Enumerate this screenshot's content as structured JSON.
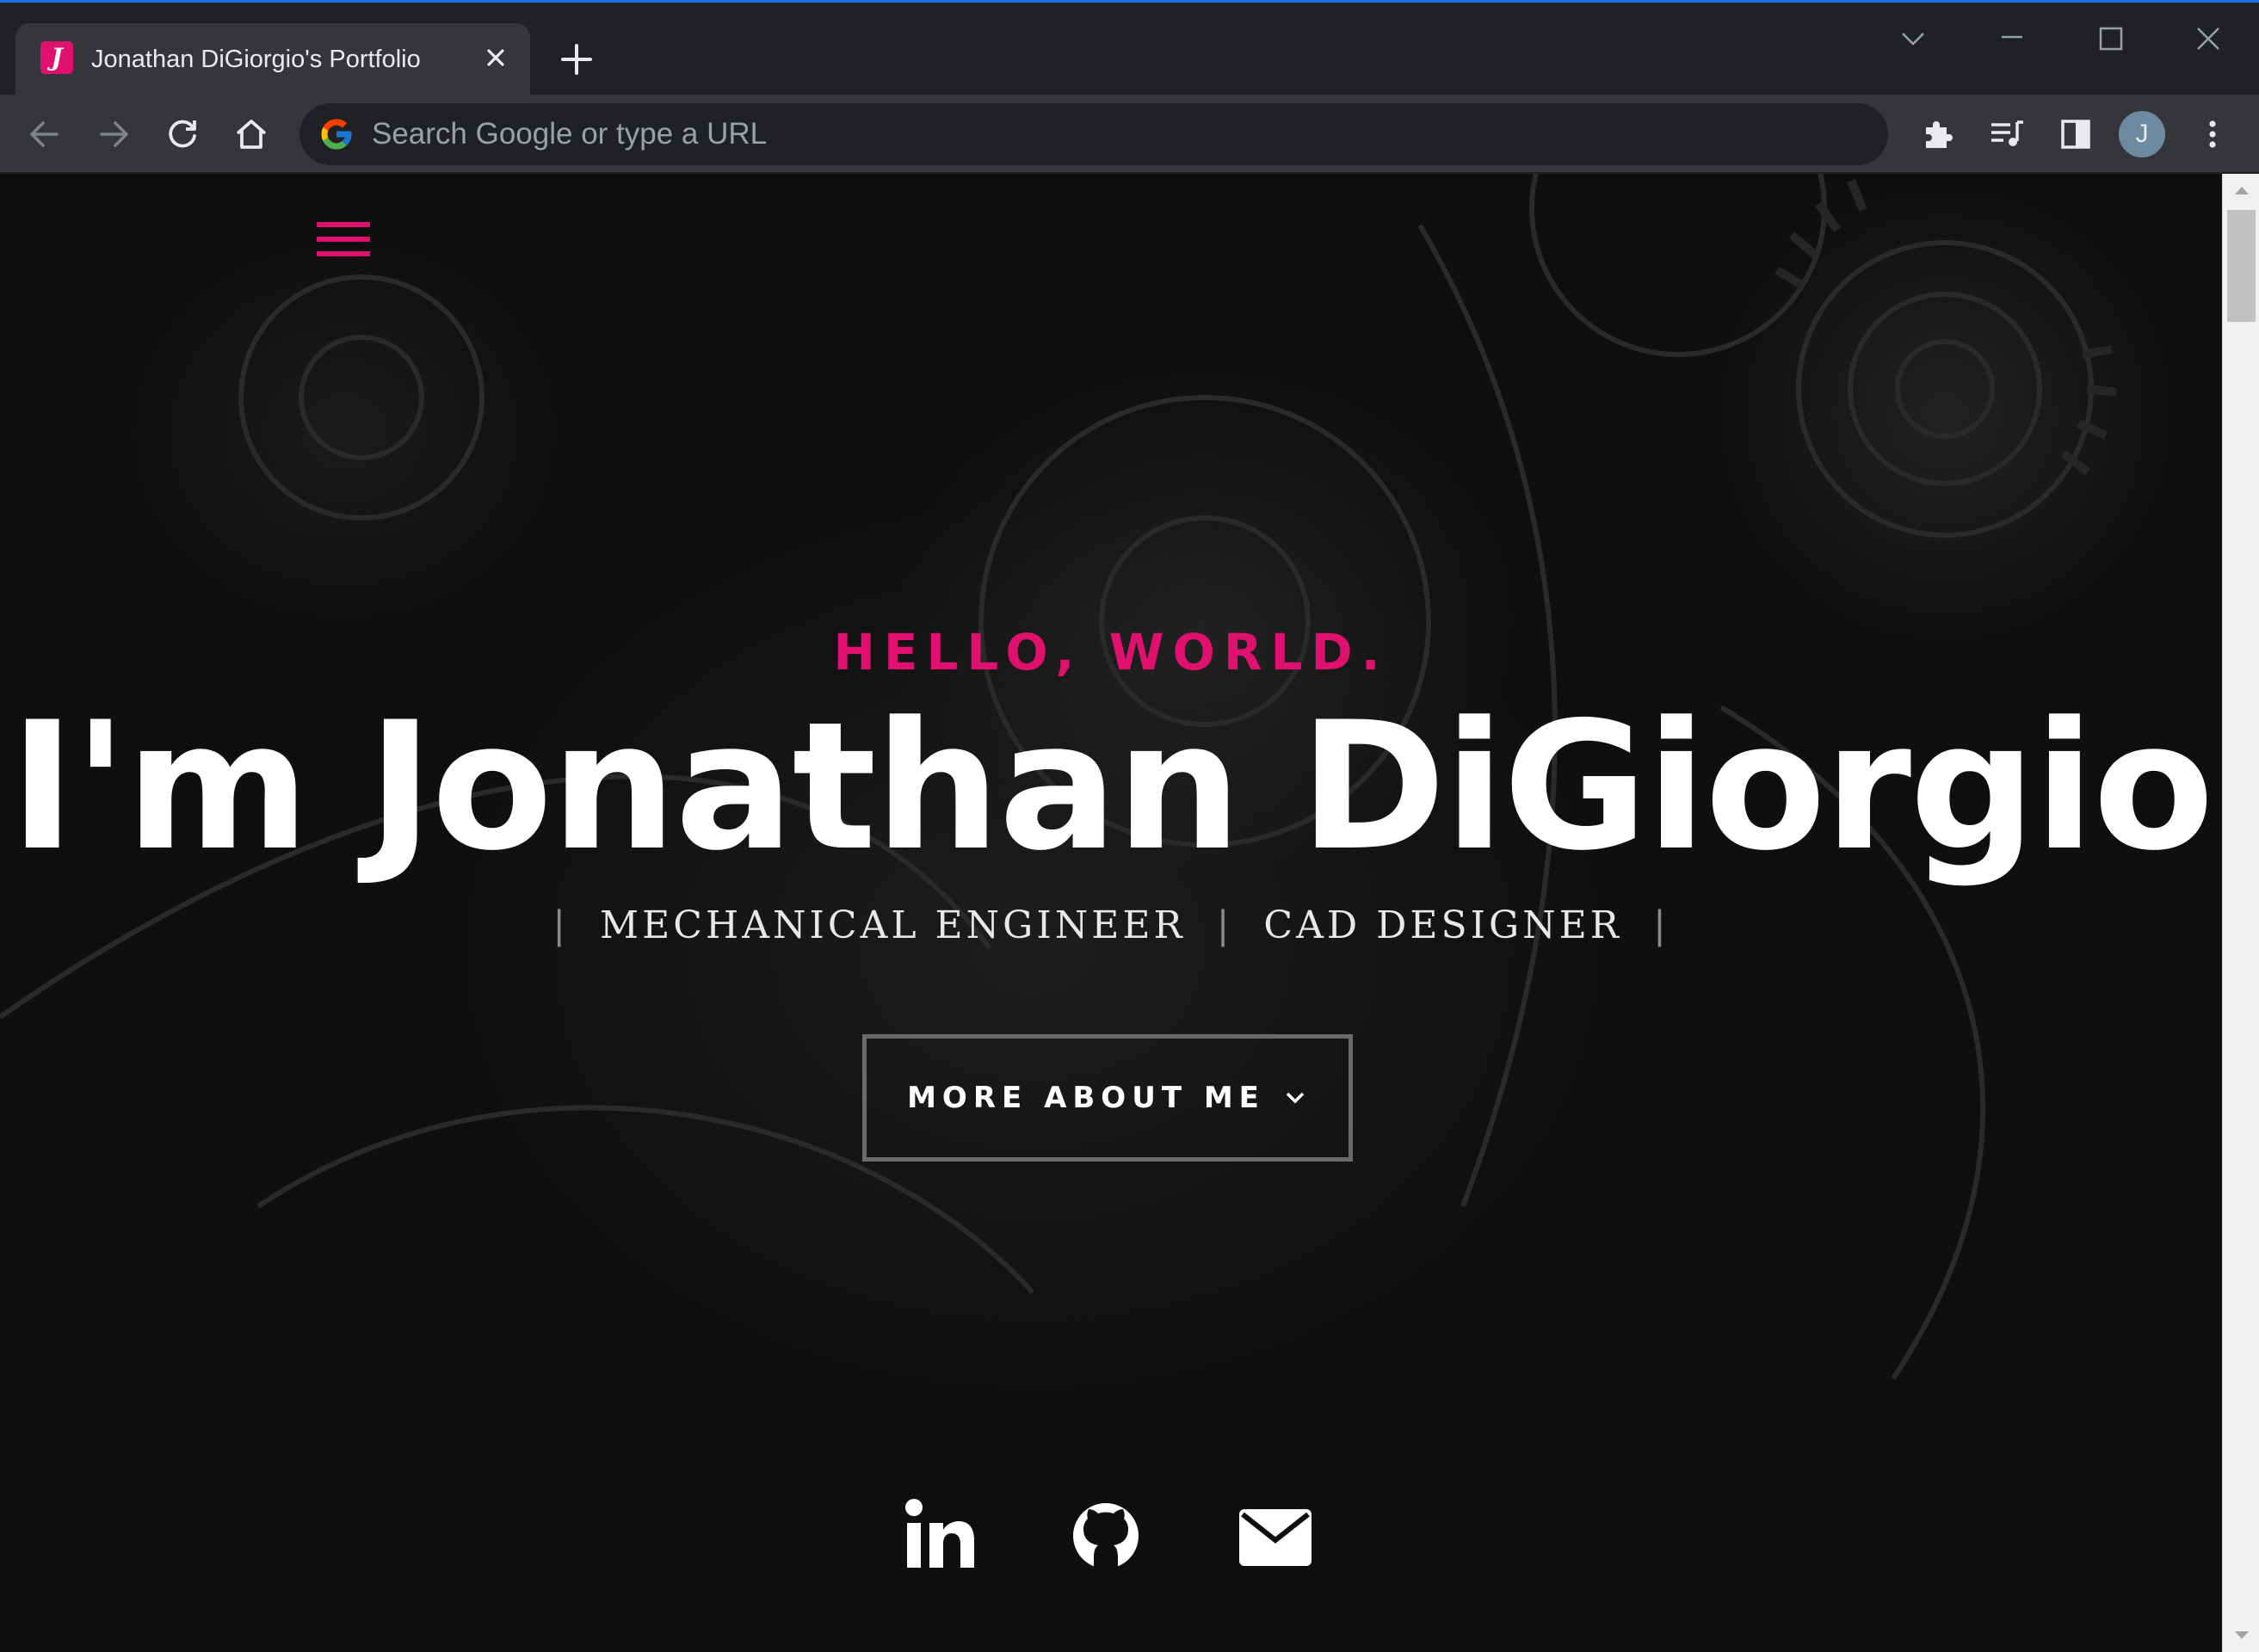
{
  "browser": {
    "tab_title": "Jonathan DiGiorgio's Portfolio",
    "favicon_letter": "J",
    "new_tab_label": "+",
    "tab_close_label": "✕",
    "omnibox_placeholder": "Search Google or type a URL",
    "profile_initial": "J",
    "accent_color": "#1a73e8"
  },
  "page": {
    "greeting": "HELLO, WORLD.",
    "headline": "I'm Jonathan DiGiorgio",
    "roles": [
      "MECHANICAL ENGINEER",
      "CAD DESIGNER"
    ],
    "role_separator": "|",
    "cta_label": "MORE ABOUT ME",
    "social": [
      "linkedin-icon",
      "github-icon",
      "email-icon"
    ],
    "brand_color": "#e0116e"
  }
}
